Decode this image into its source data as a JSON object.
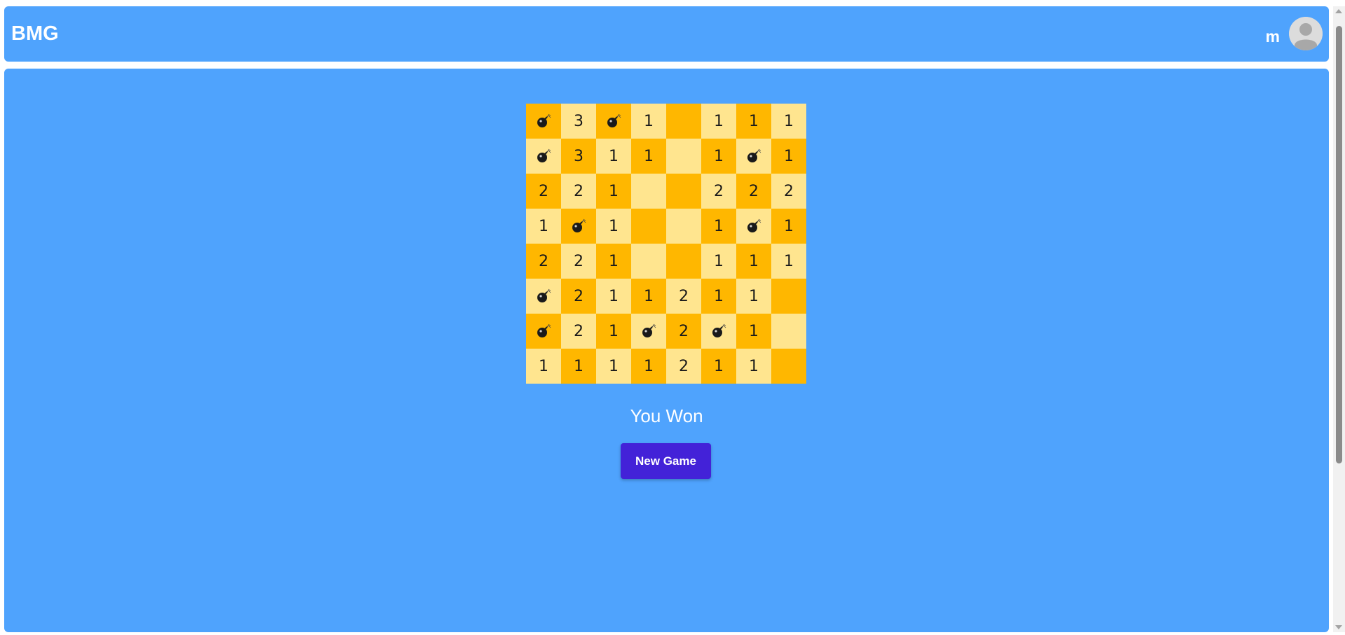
{
  "header": {
    "brand": "BMG",
    "user_name": "m"
  },
  "board": {
    "rows": [
      [
        "bomb",
        "3",
        "bomb",
        "1",
        "",
        "1",
        "1",
        "1"
      ],
      [
        "bomb",
        "3",
        "1",
        "1",
        "",
        "1",
        "bomb",
        "1"
      ],
      [
        "2",
        "2",
        "1",
        "",
        "",
        "2",
        "2",
        "2"
      ],
      [
        "1",
        "bomb",
        "1",
        "",
        "",
        "1",
        "bomb",
        "1"
      ],
      [
        "2",
        "2",
        "1",
        "",
        "",
        "1",
        "1",
        "1"
      ],
      [
        "bomb",
        "2",
        "1",
        "1",
        "2",
        "1",
        "1",
        ""
      ],
      [
        "bomb",
        "2",
        "1",
        "bomb",
        "2",
        "bomb",
        "1",
        ""
      ],
      [
        "1",
        "1",
        "1",
        "1",
        "2",
        "1",
        "1",
        ""
      ]
    ],
    "dark_color": "#ffb700",
    "light_color": "#ffe58f"
  },
  "status": "You Won",
  "new_game_label": "New Game",
  "colors": {
    "background": "#4fa3fd",
    "button": "#4322d8"
  }
}
